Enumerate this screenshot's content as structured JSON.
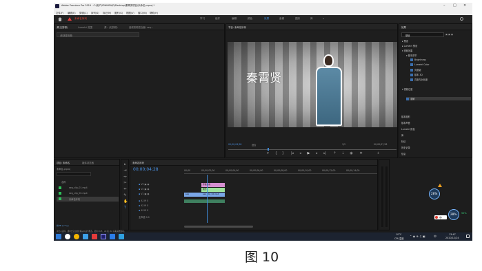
{
  "window": {
    "app_title": "Adobe Premiere Pro 2019 - C:\\用户\\IDWHEA\\D\\Desktop\\秦霄贤项目\\未命名.prproj *",
    "minimize": "–",
    "maximize": "□",
    "close": "×"
  },
  "menu": {
    "items": [
      "文件(F)",
      "编辑(E)",
      "剪辑(C)",
      "序列(S)",
      "标记(M)",
      "图形(G)",
      "视图(V)",
      "窗口(W)",
      "帮助(H)"
    ]
  },
  "header": {
    "project_name": "未命名序列",
    "workspaces": [
      "学习",
      "组件",
      "编辑",
      "颜色",
      "效果",
      "音频",
      "图形",
      "库"
    ],
    "active_workspace": "效果"
  },
  "source_panel": {
    "tabs": [
      "源(无剪辑)",
      "Lumetri 范围",
      "源：(无剪辑)",
      "音频剪辑混合器: seq..."
    ],
    "dropdown": "（未选择剪辑）"
  },
  "program_panel": {
    "tab": "节目: 未命名序列",
    "overlay_text": "秦霄贤",
    "timecode_left": "00;00;04;28",
    "fit": "适合",
    "quality": "1/2",
    "timecode_right": "00;00;07;28"
  },
  "effects_panel": {
    "tab": "效果",
    "search_value": "基础",
    "tree": [
      "预设",
      "Lumetri 预设",
      "视频效果",
      "基本调节",
      "Brightness",
      "Lumetri Color",
      "亮度键",
      "基本 3D",
      "亮度与对比度",
      "视频过渡",
      "溶解"
    ],
    "sections": [
      "基本图形",
      "基本声音",
      "Lumetri 颜色",
      "库",
      "标记",
      "历史记录",
      "信息"
    ]
  },
  "project_panel": {
    "tabs": [
      "项目: 未命名",
      "媒体浏览器"
    ],
    "file": "未命名.prproj",
    "name_header": "名称",
    "items": [
      {
        "name": "seq_clip_01.mp4",
        "color": "#2fbf5a"
      },
      {
        "name": "seq_clip_02.mp4",
        "color": "#2fbf5a"
      },
      {
        "name": "未命名序列",
        "color": "#2fbf5a"
      }
    ]
  },
  "timeline": {
    "tab": "未命名序列",
    "timecode": "00;00;04;28",
    "ruler": [
      "00;00",
      "00;00;02;00",
      "00;00;04;00",
      "00;00;06;00",
      "00;00;08;00",
      "00;00;10;00",
      "00;00;12;00",
      "00;00;14;00"
    ],
    "tracks": [
      "V3",
      "V2",
      "V1",
      "A1",
      "A2",
      "A3",
      "主声道"
    ],
    "clips": {
      "v3": "字幕素材",
      "v2": "图形",
      "v1a": "seq",
      "v1b": "seq_clip_02.mp4"
    },
    "master_value": "0.0"
  },
  "status_bar": {
    "text": "单击以选择，或单击空白处并拖动以进行框选。使用 Shift、Alt 和 Ctrl 获取其他选项。"
  },
  "widgets": {
    "cpu1": "28%",
    "cpu2": "28%",
    "mem": "50%"
  },
  "taskbar": {
    "weather": "10°C",
    "weather_sub": "CPU温度",
    "time": "13:47",
    "date": "2020/12/24",
    "ime": "中"
  },
  "caption": "图 10",
  "colors": {
    "accent_blue": "#3f8ad7",
    "clip_pink": "#d58fd0",
    "clip_green": "#9ee29b",
    "clip_blue": "#7aa7e8"
  }
}
